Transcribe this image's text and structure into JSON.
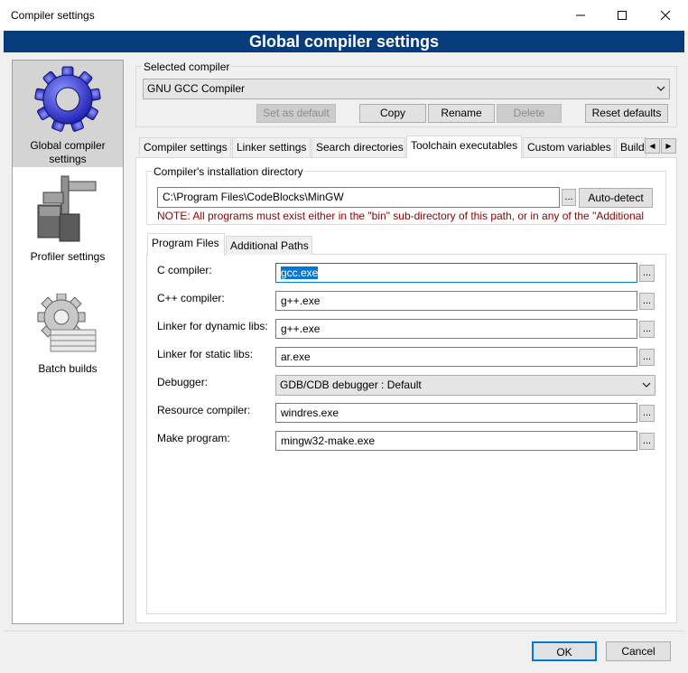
{
  "window": {
    "title": "Compiler settings",
    "banner": "Global compiler settings"
  },
  "sidebar": {
    "items": [
      {
        "label": "Global compiler settings",
        "icon": "gear-icon"
      },
      {
        "label": "Profiler settings",
        "icon": "caliper-icon"
      },
      {
        "label": "Batch builds",
        "icon": "batch-gear-icon"
      }
    ]
  },
  "compiler": {
    "group_label": "Selected compiler",
    "selected": "GNU GCC Compiler",
    "buttons": {
      "set_default": "Set as default",
      "copy": "Copy",
      "rename": "Rename",
      "delete": "Delete",
      "reset_defaults": "Reset defaults"
    }
  },
  "tabs": [
    "Compiler settings",
    "Linker settings",
    "Search directories",
    "Toolchain executables",
    "Custom variables",
    "Build"
  ],
  "install": {
    "group_label": "Compiler's installation directory",
    "path": "C:\\Program Files\\CodeBlocks\\MinGW",
    "browse": "...",
    "auto_detect": "Auto-detect",
    "note": "NOTE: All programs must exist either in the \"bin\" sub-directory of this path, or in any of the \"Additional"
  },
  "subtabs": [
    "Program Files",
    "Additional Paths"
  ],
  "programs": {
    "c_compiler": {
      "label": "C compiler:",
      "value": "gcc.exe"
    },
    "cpp_compiler": {
      "label": "C++ compiler:",
      "value": "g++.exe"
    },
    "linker_dynamic": {
      "label": "Linker for dynamic libs:",
      "value": "g++.exe"
    },
    "linker_static": {
      "label": "Linker for static libs:",
      "value": "ar.exe"
    },
    "debugger": {
      "label": "Debugger:",
      "value": "GDB/CDB debugger : Default"
    },
    "resource_compiler": {
      "label": "Resource compiler:",
      "value": "windres.exe"
    },
    "make_program": {
      "label": "Make program:",
      "value": "mingw32-make.exe"
    },
    "browse": "..."
  },
  "footer": {
    "ok": "OK",
    "cancel": "Cancel"
  }
}
